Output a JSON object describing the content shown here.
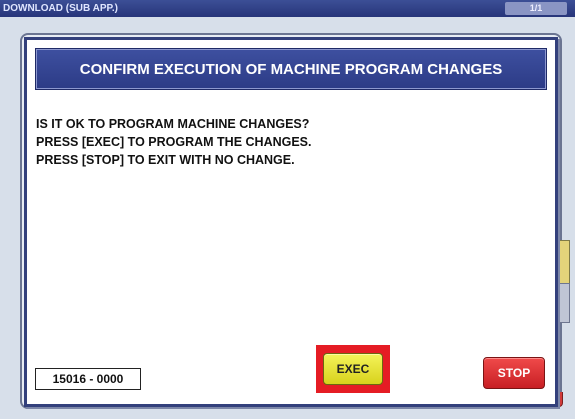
{
  "titlebar": {
    "title": "DOWNLOAD (SUB APP.)",
    "page_indicator": "1/1"
  },
  "dialog": {
    "header": "CONFIRM EXECUTION OF MACHINE PROGRAM CHANGES",
    "messages": [
      "IS IT OK TO PROGRAM MACHINE CHANGES?",
      "PRESS [EXEC] TO PROGRAM THE CHANGES.",
      "PRESS [STOP] TO EXIT WITH NO CHANGE."
    ],
    "code": "15016 - 0000",
    "exec_label": "EXEC",
    "stop_label": "STOP"
  },
  "colors": {
    "title_bar": "#2f3f86",
    "header": "#34459a",
    "exec_button": "#eeea3a",
    "exec_highlight": "#e51c24",
    "stop_button": "#e0363a"
  }
}
